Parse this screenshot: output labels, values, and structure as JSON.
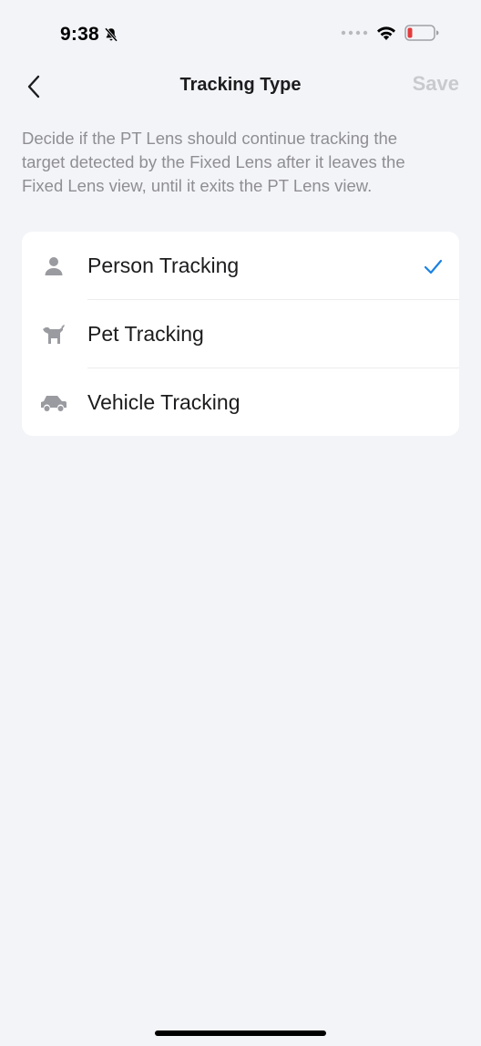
{
  "status_bar": {
    "time": "9:38",
    "icons": [
      "bell-slash-icon",
      "cellular-dots-icon",
      "wifi-icon",
      "battery-low-icon"
    ],
    "battery_color": "#e23b3b"
  },
  "nav": {
    "back_icon": "chevron-left-icon",
    "title": "Tracking Type",
    "save_label": "Save"
  },
  "description": "Decide if the PT Lens should continue tracking the target detected by the Fixed Lens after it leaves the Fixed Lens view, until it exits the PT Lens view.",
  "options": [
    {
      "label": "Person Tracking",
      "icon": "person-icon",
      "selected": true
    },
    {
      "label": "Pet Tracking",
      "icon": "dog-icon",
      "selected": false
    },
    {
      "label": "Vehicle Tracking",
      "icon": "car-icon",
      "selected": false
    }
  ],
  "colors": {
    "background": "#f3f4f8",
    "check": "#1a82e2",
    "icon_gray": "#9a9ba0",
    "save_disabled": "#c9cacd"
  }
}
